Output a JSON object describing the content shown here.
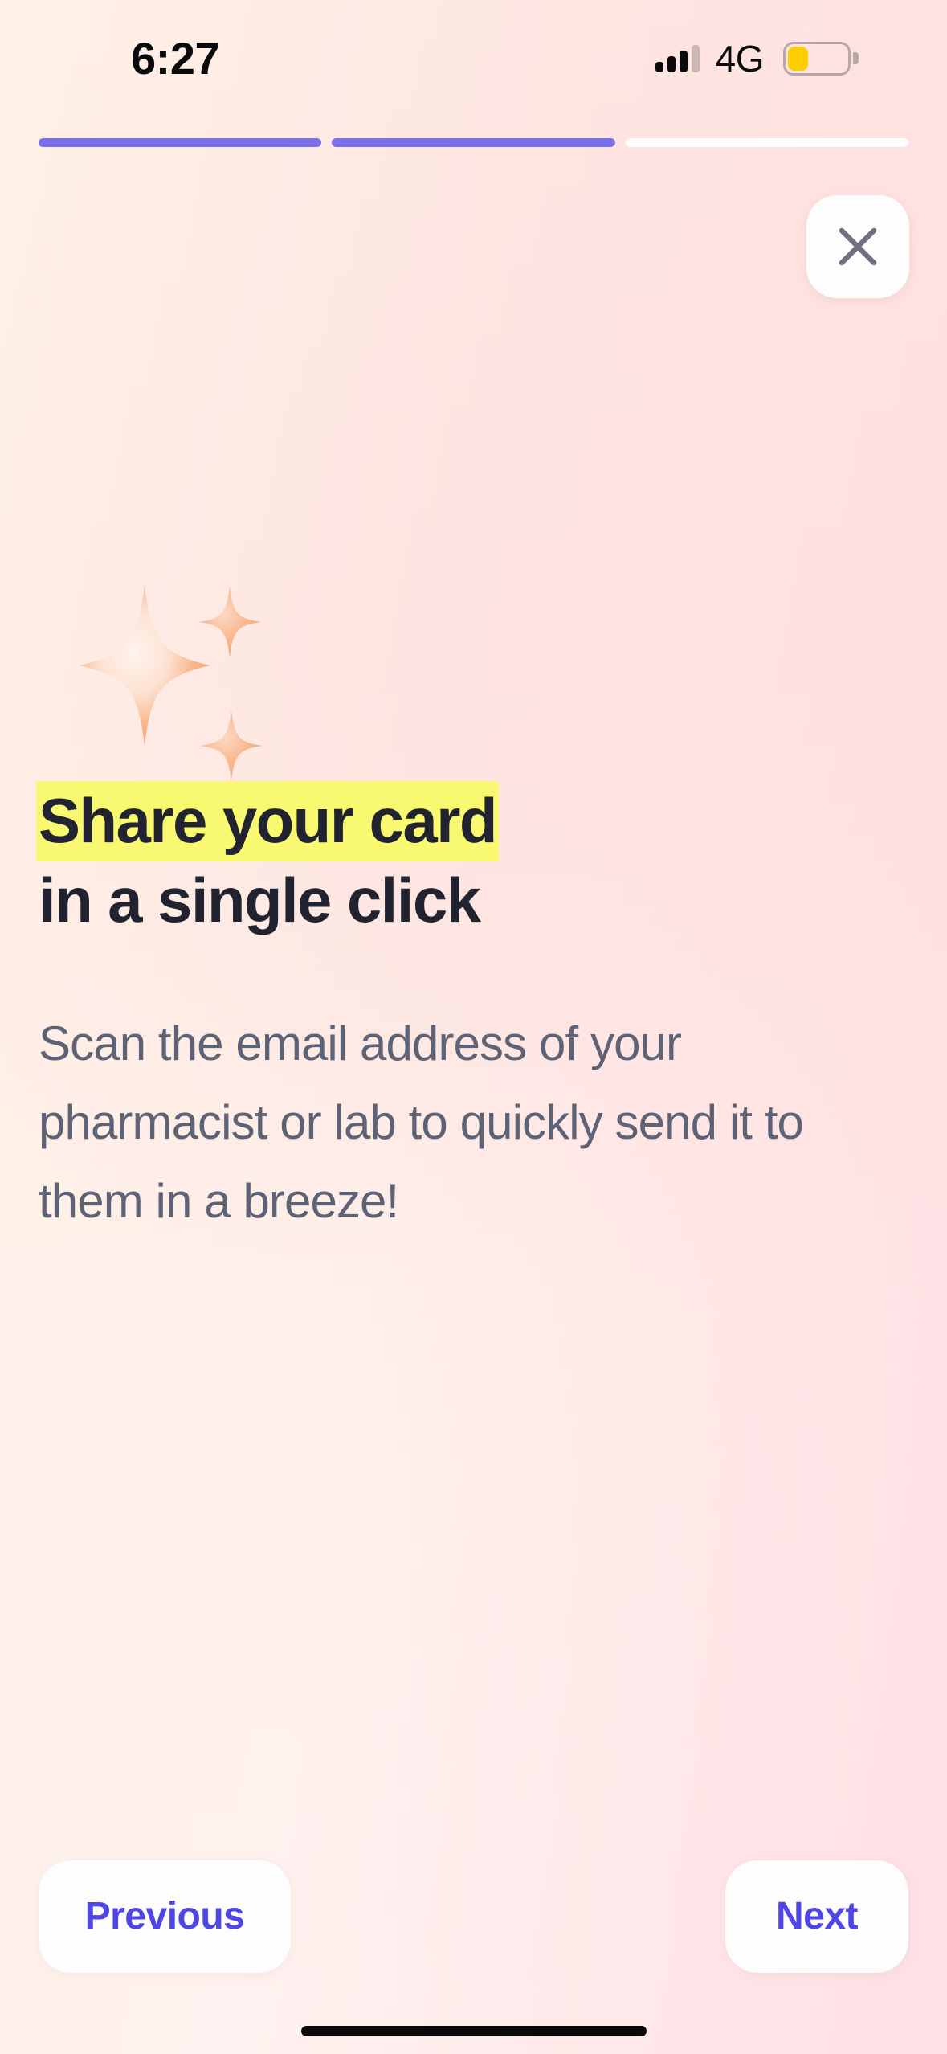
{
  "status_bar": {
    "time": "6:27",
    "carrier_label": "4G",
    "signal_icon": "signal-bars-icon",
    "signal_bars_total": 4,
    "signal_bars_active": 3,
    "battery_icon": "battery-low-icon",
    "battery_level_percent": 35,
    "battery_color": "#fcce00"
  },
  "progress": {
    "total_steps": 3,
    "current_step": 2,
    "filled_color": "#7a70ea",
    "empty_color": "#ffffff"
  },
  "header": {
    "close_icon": "close-icon",
    "close_label": "Close"
  },
  "hero": {
    "illustration_icon": "sparkles-icon",
    "sparkle_count": 3,
    "sparkle_color": "#f7a97a"
  },
  "content": {
    "headline_highlighted": "Share your card",
    "headline_rest": "in a single click",
    "highlight_color": "#f9f871",
    "headline_color": "#212430",
    "body": "Scan the email address of your pharmacist or lab to quickly send it to them in a breeze!",
    "body_color": "#5e6275"
  },
  "footer": {
    "previous_label": "Previous",
    "next_label": "Next",
    "button_text_color": "#4f46e5"
  },
  "system": {
    "home_indicator": "home-indicator"
  }
}
